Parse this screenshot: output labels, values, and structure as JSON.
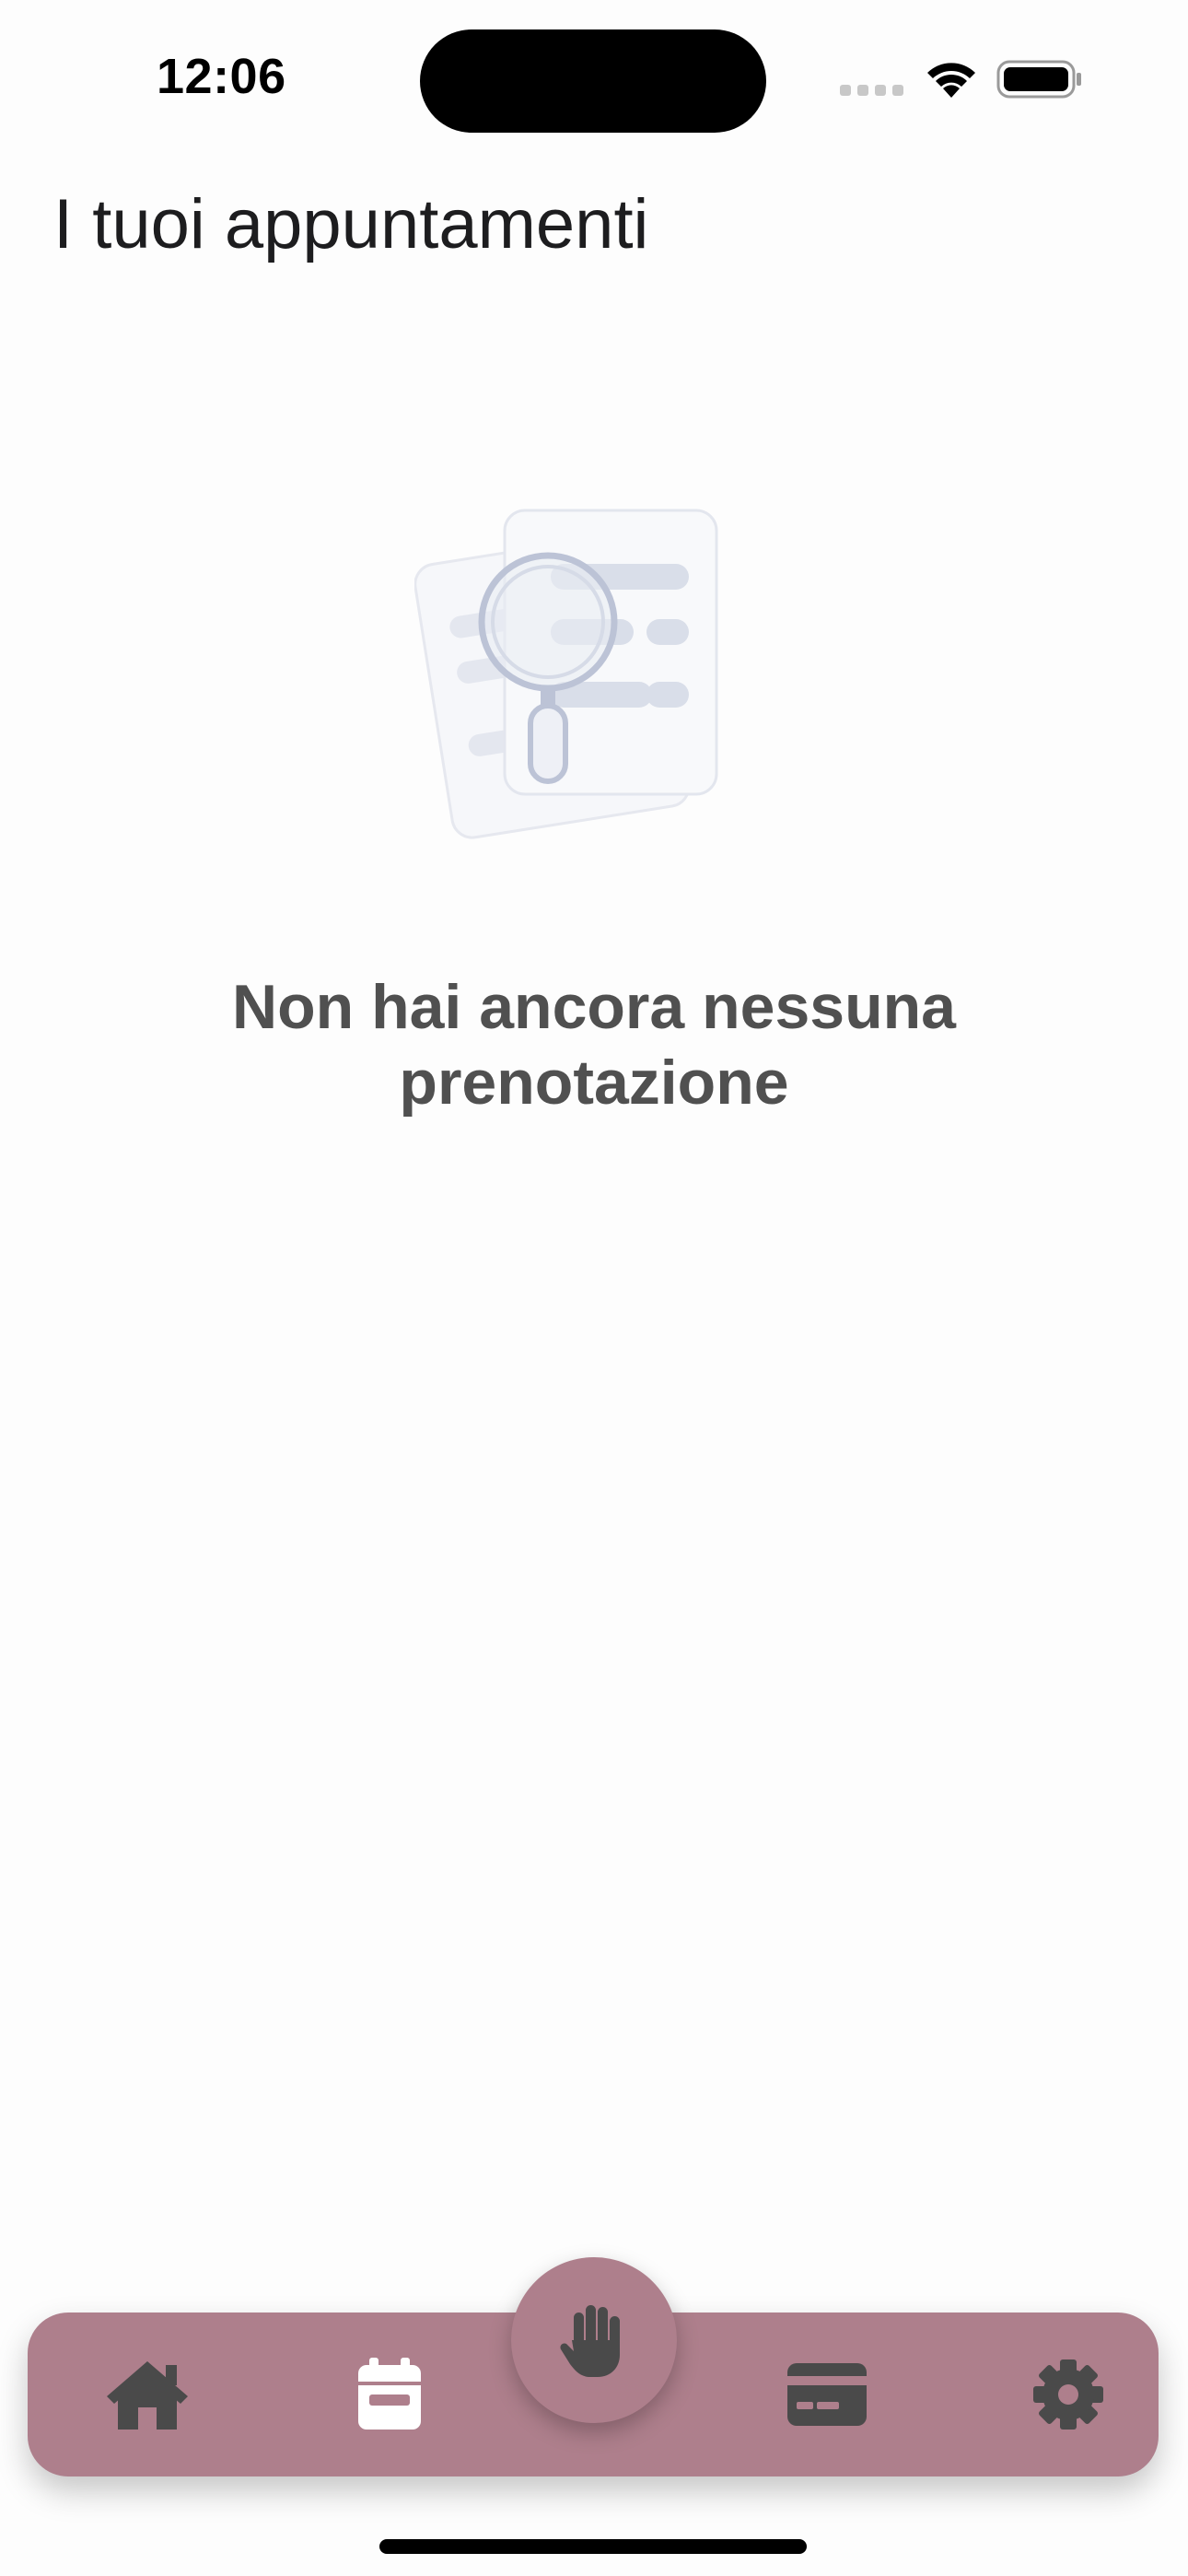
{
  "status_bar": {
    "time": "12:06"
  },
  "header": {
    "title": "I tuoi appuntamenti"
  },
  "empty_state": {
    "icon": "document-search-icon",
    "message": "Non hai ancora nessuna prenotazione"
  },
  "tab_bar": {
    "background_color": "#ae7f8c",
    "items": [
      {
        "icon": "home-icon",
        "active": false
      },
      {
        "icon": "calendar-icon",
        "active": true
      },
      {
        "icon": "hand-icon",
        "center": true
      },
      {
        "icon": "credit-card-icon",
        "active": false
      },
      {
        "icon": "gear-icon",
        "active": false
      }
    ]
  },
  "colors": {
    "accent": "#ae7f8c",
    "icon_inactive": "#4a4a4a",
    "icon_active": "#ffffff",
    "message_text": "#505050"
  }
}
